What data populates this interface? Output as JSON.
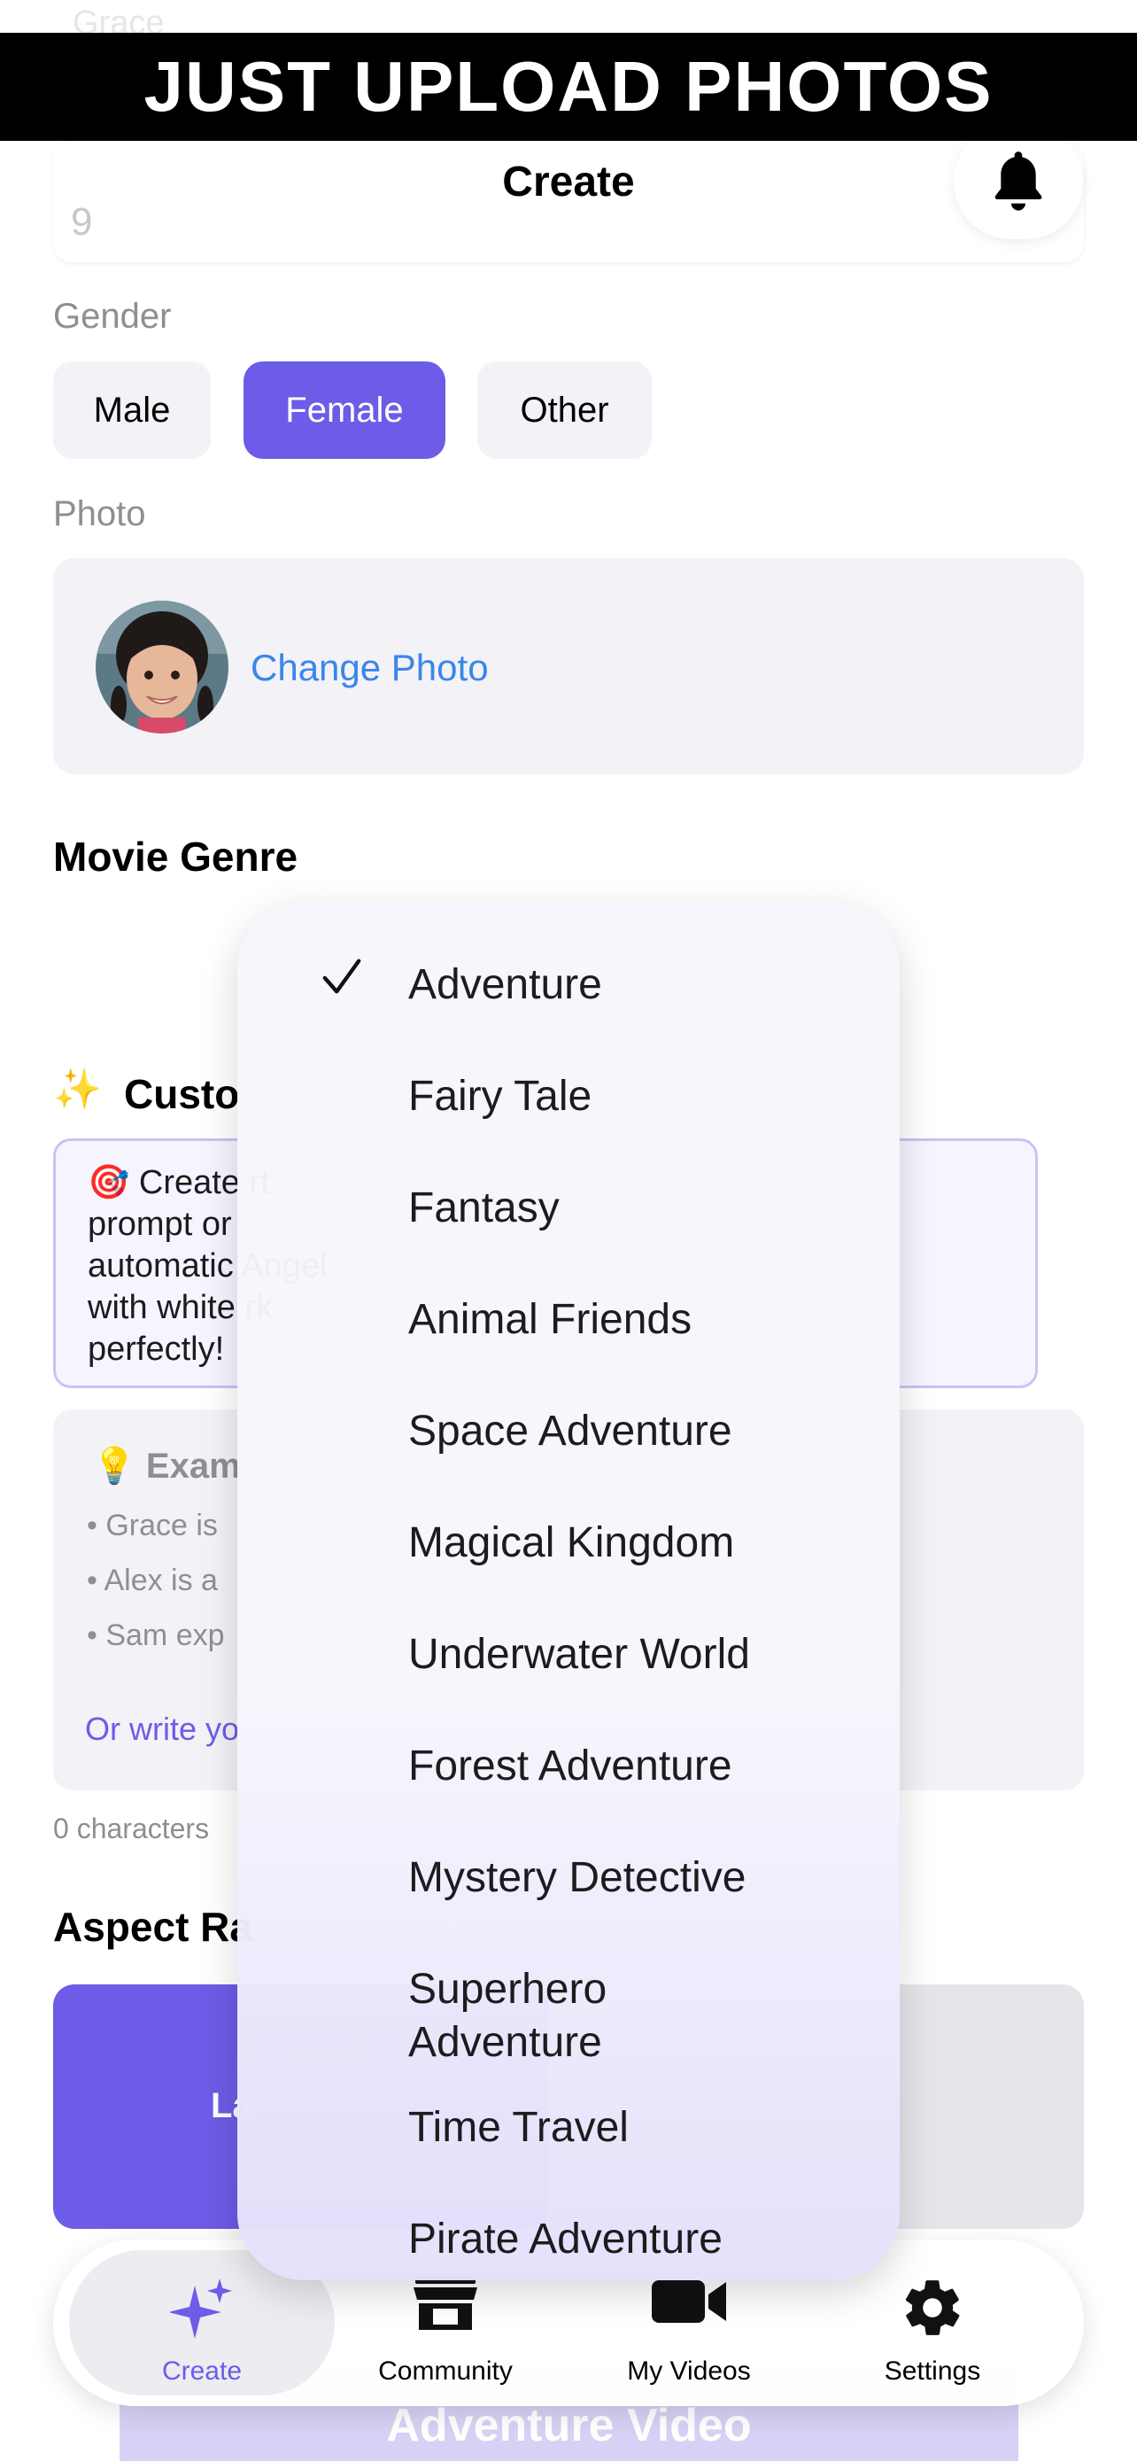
{
  "banner": {
    "text": "JUST UPLOAD PHOTOS"
  },
  "header": {
    "title": "Create",
    "faded_label": "Grace",
    "age_value": "9"
  },
  "gender": {
    "label": "Gender",
    "options": [
      {
        "label": "Male",
        "selected": false
      },
      {
        "label": "Female",
        "selected": true
      },
      {
        "label": "Other",
        "selected": false
      }
    ]
  },
  "photo": {
    "label": "Photo",
    "change_label": "Change Photo"
  },
  "movie_genre": {
    "heading": "Movie Genre",
    "selected": "Adventure"
  },
  "custom": {
    "heading_visible": "Custo",
    "prompt_visible": "🎯 Create                                                                        rt\nprompt or\nautomatic                                                                         Angel\nwith white                                                                           rk\nperfectly!"
  },
  "examples": {
    "title": "💡 Exam",
    "items": [
      "• Grace is",
      "• Alex is a",
      "• Sam exp"
    ],
    "link": "Or write yo"
  },
  "char_count": "0 characters",
  "aspect": {
    "heading": "Aspect Ra",
    "selected_visible": "La"
  },
  "cta": {
    "label": "Adventure Video"
  },
  "dropdown": {
    "items": [
      "Adventure",
      "Fairy Tale",
      "Fantasy",
      "Animal Friends",
      "Space Adventure",
      "Magical Kingdom",
      "Underwater World",
      "Forest Adventure",
      "Mystery Detective",
      "Superhero Adventure",
      "Time Travel",
      "Pirate Adventure"
    ]
  },
  "tabbar": {
    "items": [
      {
        "label": "Create",
        "icon": "sparkles-icon",
        "active": true
      },
      {
        "label": "Community",
        "icon": "storefront-icon",
        "active": false
      },
      {
        "label": "My Videos",
        "icon": "video-camera-icon",
        "active": false
      },
      {
        "label": "Settings",
        "icon": "gear-icon",
        "active": false
      }
    ]
  },
  "colors": {
    "accent": "#6c5ce7",
    "link": "#3a86e8",
    "surface": "#f2f2f7"
  }
}
